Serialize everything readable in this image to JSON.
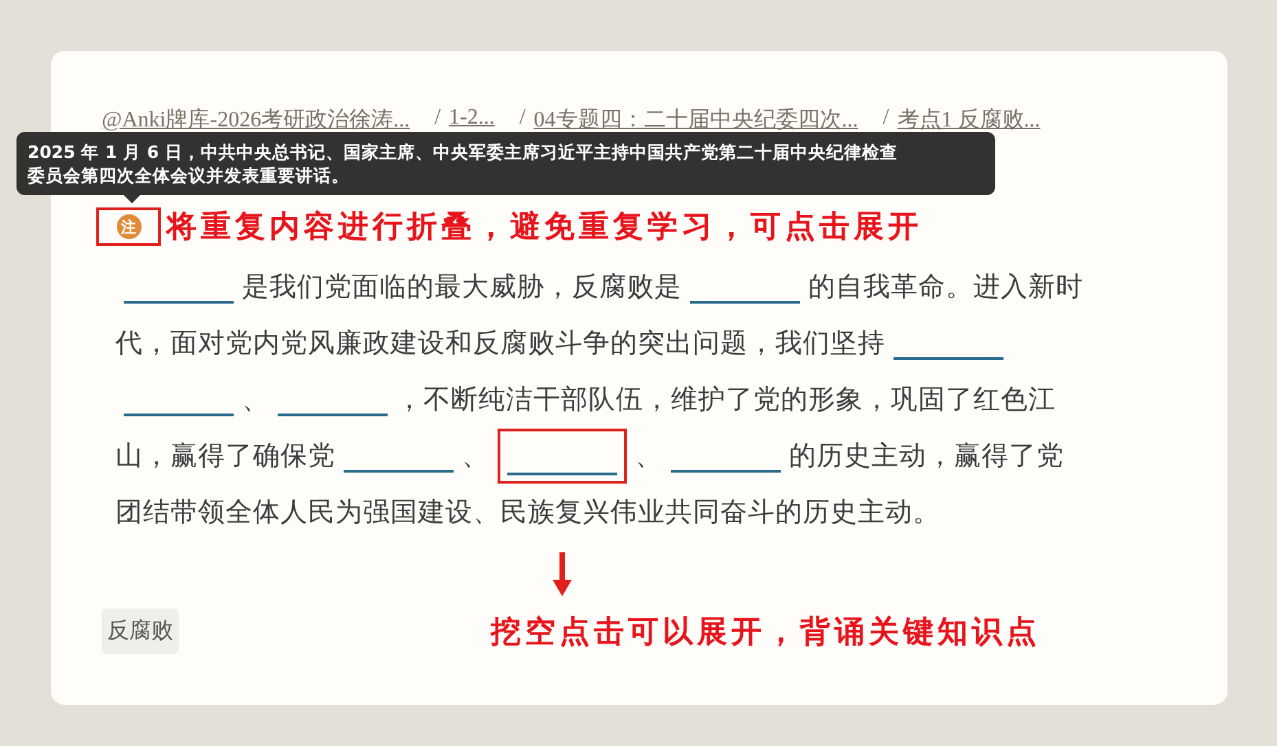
{
  "breadcrumb": [
    {
      "label": "@Anki牌库-2026考研政治徐涛..."
    },
    {
      "separator": "/",
      "label": "1-2..."
    },
    {
      "separator": "/",
      "label": "04专题四：二十届中央纪委四次..."
    },
    {
      "separator": "/",
      "label": "考点1 反腐败..."
    }
  ],
  "note": {
    "icon": "注",
    "tooltip": "2025 年 1 月 6 日，中共中央总书记、国家主席、中央军委主席习近平主持中国共产党第二十届中央纪律检查委员会第四次全体会议并发表重要讲话。",
    "annotation": "将重复内容进行折叠，避免重复学习，可点击展开"
  },
  "paragraph_lines": [
    [
      {
        "kind": "blank",
        "highlighted": false
      },
      {
        "kind": "text",
        "text": "是我们党面临的最大威胁，反腐败是"
      },
      {
        "kind": "blank",
        "highlighted": false
      },
      {
        "kind": "text",
        "text": "的自我革命。进入新时"
      }
    ],
    [
      {
        "kind": "text",
        "text": "代，面对党内党风廉政建设和反腐败斗争的突出问题，我们坚持"
      },
      {
        "kind": "blank",
        "highlighted": false
      }
    ],
    [
      {
        "kind": "blank",
        "highlighted": false
      },
      {
        "kind": "text",
        "text": "、"
      },
      {
        "kind": "blank",
        "highlighted": false
      },
      {
        "kind": "text",
        "text": "，不断纯洁干部队伍，维护了党的形象，巩固了红色江"
      }
    ],
    [
      {
        "kind": "text",
        "text": "山，赢得了确保党"
      },
      {
        "kind": "blank",
        "highlighted": false
      },
      {
        "kind": "text",
        "text": "、"
      },
      {
        "kind": "blank",
        "highlighted": true
      },
      {
        "kind": "text",
        "text": "、"
      },
      {
        "kind": "blank",
        "highlighted": false
      },
      {
        "kind": "text",
        "text": "的历史主动，赢得了党"
      }
    ],
    [
      {
        "kind": "text",
        "text": "团结带领全体人民为强国建设、民族复兴伟业共同奋斗的历史主动。"
      }
    ]
  ],
  "tag": "反腐败",
  "blank_annotation": "挖空点击可以展开，背诵关键知识点"
}
